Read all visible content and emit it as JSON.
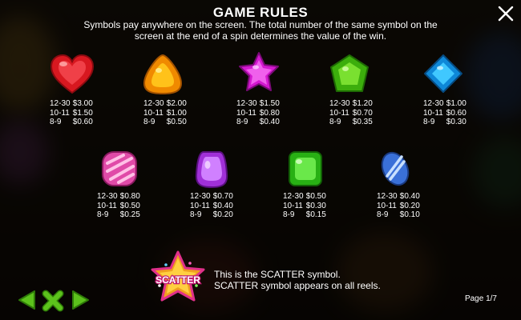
{
  "dialog": {
    "title": "GAME RULES",
    "description_line1": "Symbols pay anywhere on the screen. The total number of the same symbol on the",
    "description_line2": "screen at the end of a spin determines the value of the win."
  },
  "symbols_row1": [
    {
      "icon": "red-heart-candy-icon",
      "color": "#e8202a",
      "pays": [
        [
          "12-30",
          "$3.00"
        ],
        [
          "10-11",
          "$1.50"
        ],
        [
          "8-9",
          "$0.60"
        ]
      ]
    },
    {
      "icon": "orange-triangle-candy-icon",
      "color": "#f59a0a",
      "pays": [
        [
          "12-30",
          "$2.00"
        ],
        [
          "10-11",
          "$1.00"
        ],
        [
          "8-9",
          "$0.50"
        ]
      ]
    },
    {
      "icon": "purple-star-candy-icon",
      "color": "#e02ad8",
      "pays": [
        [
          "12-30",
          "$1.50"
        ],
        [
          "10-11",
          "$0.80"
        ],
        [
          "8-9",
          "$0.40"
        ]
      ]
    },
    {
      "icon": "green-pentagon-candy-icon",
      "color": "#4cc619",
      "pays": [
        [
          "12-30",
          "$1.20"
        ],
        [
          "10-11",
          "$0.70"
        ],
        [
          "8-9",
          "$0.35"
        ]
      ]
    },
    {
      "icon": "blue-square-candy-icon",
      "color": "#1aa9ee",
      "pays": [
        [
          "12-30",
          "$1.00"
        ],
        [
          "10-11",
          "$0.60"
        ],
        [
          "8-9",
          "$0.30"
        ]
      ]
    }
  ],
  "symbols_row2": [
    {
      "icon": "pink-striped-candy-icon",
      "color": "#f060b4",
      "pays": [
        [
          "12-30",
          "$0.80"
        ],
        [
          "10-11",
          "$0.50"
        ],
        [
          "8-9",
          "$0.25"
        ]
      ]
    },
    {
      "icon": "violet-drop-candy-icon",
      "color": "#b246e8",
      "pays": [
        [
          "12-30",
          "$0.70"
        ],
        [
          "10-11",
          "$0.40"
        ],
        [
          "8-9",
          "$0.20"
        ]
      ]
    },
    {
      "icon": "green-square-candy-icon",
      "color": "#3ed12a",
      "pays": [
        [
          "12-30",
          "$0.50"
        ],
        [
          "10-11",
          "$0.30"
        ],
        [
          "8-9",
          "$0.15"
        ]
      ]
    },
    {
      "icon": "blue-oval-candy-icon",
      "color": "#6a9ef0",
      "pays": [
        [
          "12-30",
          "$0.40"
        ],
        [
          "10-11",
          "$0.20"
        ],
        [
          "8-9",
          "$0.10"
        ]
      ]
    }
  ],
  "scatter": {
    "badge_text": "SCATTER",
    "line1": "This is the SCATTER symbol.",
    "line2": "SCATTER symbol appears on all reels."
  },
  "footer": {
    "page_indicator": "Page 1/7"
  },
  "colors": {
    "nav_green": "#5cc21c",
    "overlay": "#000000"
  }
}
